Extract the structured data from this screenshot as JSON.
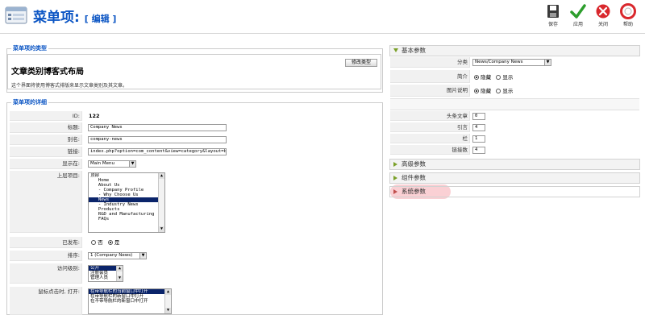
{
  "header": {
    "title": "菜单项:",
    "subtitle": "[ 编辑 ]",
    "toolbar": {
      "save": "保存",
      "apply": "应用",
      "close": "关闭",
      "help": "帮助"
    }
  },
  "menu_type": {
    "legend": "菜单项的类型",
    "name": "文章类别博客式布局",
    "description": "这个界面将使用博客式排版来显示文章类别及其文章。",
    "change_button": "修改类型"
  },
  "details": {
    "legend": "菜单项的详细",
    "id_label": "ID:",
    "id_value": "122",
    "title_label": "标题:",
    "title_value": "Company News",
    "alias_label": "别名:",
    "alias_value": "company-news",
    "link_label": "链接:",
    "link_value": "index.php?option=com_content&view=category&layout=b",
    "display_in_label": "显示在:",
    "display_in_value": "Main Menu",
    "parent_label": "上层项目:",
    "parent_options": [
      {
        "text": "顶部",
        "selected": false
      },
      {
        "text": "   Home",
        "selected": false
      },
      {
        "text": "   About Us",
        "selected": false
      },
      {
        "text": "   - Company Profile",
        "selected": false
      },
      {
        "text": "   - Why Choose Us",
        "selected": false
      },
      {
        "text": "   News",
        "selected": true
      },
      {
        "text": "   - Industry News",
        "selected": false
      },
      {
        "text": "   Products",
        "selected": false
      },
      {
        "text": "   R&D and Manufacturing",
        "selected": false
      },
      {
        "text": "   FAQs",
        "selected": false
      }
    ],
    "published_label": "已发布:",
    "published_no": "否",
    "published_yes": "是",
    "order_label": "排序:",
    "order_value": "1 (Company News)",
    "access_label": "访问级别:",
    "access_options": [
      {
        "text": "公开",
        "selected": true
      },
      {
        "text": "注册会员",
        "selected": false
      },
      {
        "text": "管理人员",
        "selected": false
      }
    ],
    "target_label": "鼠标点击时, 打开:",
    "target_options": [
      {
        "text": "在带导航栏的当前窗口中打开",
        "selected": true
      },
      {
        "text": "在带导航栏的新窗口中打开",
        "selected": false
      },
      {
        "text": "在不带导航栏的新窗口中打开",
        "selected": false
      }
    ]
  },
  "params": {
    "basic_title": "基本参数",
    "category_label": "分类",
    "category_value": "News/Company News",
    "intro_label": "简介",
    "hide": "隐藏",
    "show": "显示",
    "image_desc_label": "图片说明",
    "leading_label": "头条文章",
    "leading_value": "0",
    "intro_count_label": "引言",
    "intro_count_value": "4",
    "columns_label": "栏",
    "columns_value": "1",
    "links_label": "链接数",
    "links_value": "4",
    "advanced_title": "高级参数",
    "component_title": "组件参数",
    "system_title": "系统参数"
  }
}
